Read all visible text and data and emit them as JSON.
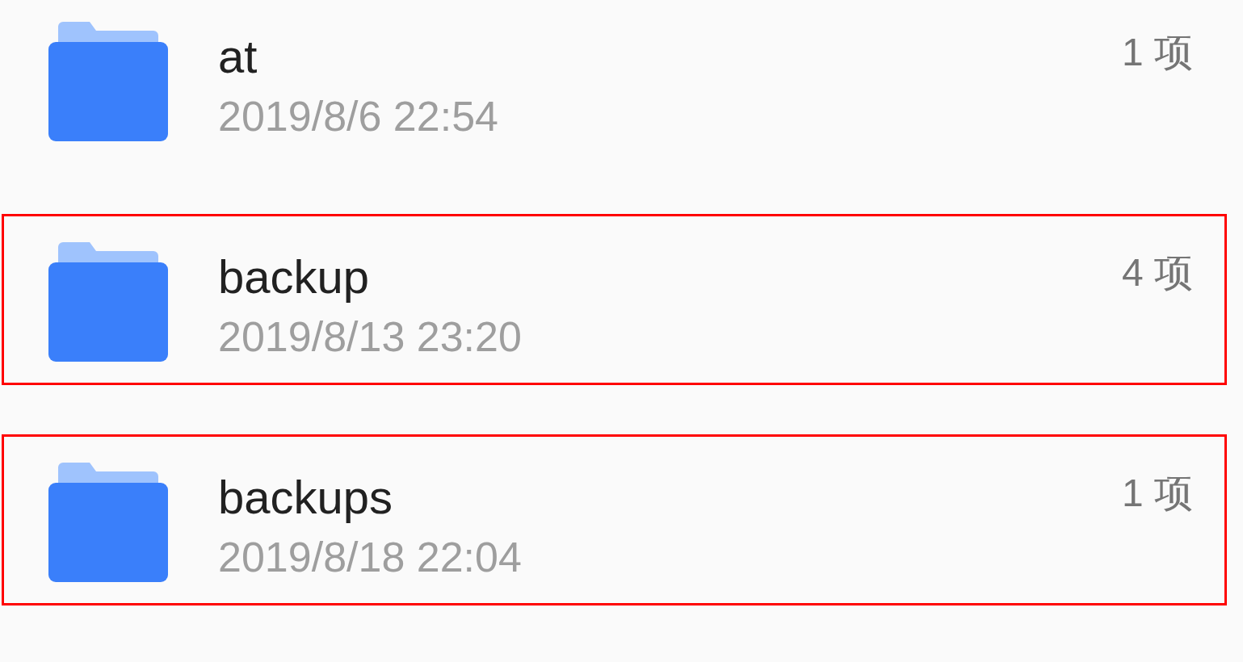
{
  "rows": [
    {
      "name": "at",
      "modified": "2019/8/6 22:54",
      "count": "1 项",
      "highlighted": false
    },
    {
      "name": "backup",
      "modified": "2019/8/13 23:20",
      "count": "4 项",
      "highlighted": true
    },
    {
      "name": "backups",
      "modified": "2019/8/18 22:04",
      "count": "1 项",
      "highlighted": true
    }
  ]
}
